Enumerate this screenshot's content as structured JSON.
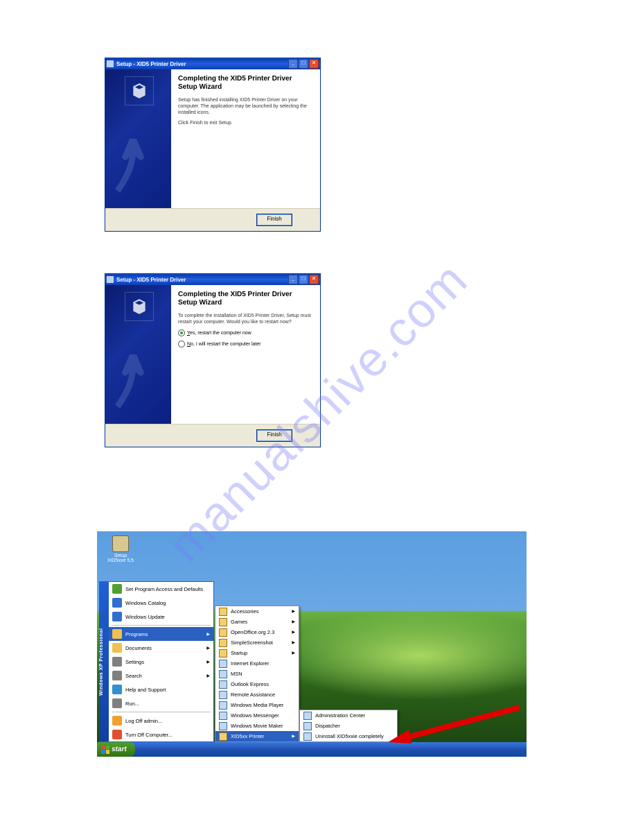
{
  "watermark": "manualshive.com",
  "dialog1": {
    "title": "Setup - XID5 Printer Driver",
    "titlebar_buttons": {
      "minimize": "_",
      "maximize": "□",
      "close": "×"
    },
    "heading": "Completing the XID5 Printer Driver Setup Wizard",
    "body1": "Setup has finished installing XID5 Printer Driver on your computer. The application may be launched by selecting the installed icons.",
    "body2": "Click Finish to exit Setup.",
    "finish": "Finish"
  },
  "dialog2": {
    "title": "Setup - XID5 Printer Driver",
    "titlebar_buttons": {
      "minimize": "_",
      "maximize": "□",
      "close": "×"
    },
    "heading": "Completing the XID5 Printer Driver Setup Wizard",
    "body1": "To complete the installation of XID5 Printer Driver, Setup must restart your computer. Would you like to restart now?",
    "radio_yes": "Yes, restart the computer now",
    "radio_no": "No, I will restart the computer later",
    "finish": "Finish"
  },
  "desktop": {
    "icon_label": "Setup XID5xxe 5.5",
    "sideband": "Windows XP  Professional",
    "start_label": "start",
    "startmenu_top": [
      {
        "label": "Set Program Access and Defaults"
      },
      {
        "label": "Windows Catalog"
      },
      {
        "label": "Windows Update"
      }
    ],
    "startmenu_main": [
      {
        "label": "Programs",
        "arrow": true,
        "highlight": true
      },
      {
        "label": "Documents",
        "arrow": true
      },
      {
        "label": "Settings",
        "arrow": true
      },
      {
        "label": "Search",
        "arrow": true
      },
      {
        "label": "Help and Support"
      },
      {
        "label": "Run..."
      }
    ],
    "startmenu_bottom": [
      {
        "label": "Log Off admin..."
      },
      {
        "label": "Turn Off Computer..."
      }
    ],
    "programs_menu": [
      {
        "label": "Accessories",
        "arrow": true
      },
      {
        "label": "Games",
        "arrow": true
      },
      {
        "label": "OpenOffice.org 2.3",
        "arrow": true
      },
      {
        "label": "SimpleScreenshot",
        "arrow": true
      },
      {
        "label": "Startup",
        "arrow": true
      },
      {
        "label": "Internet Explorer"
      },
      {
        "label": "MSN"
      },
      {
        "label": "Outlook Express"
      },
      {
        "label": "Remote Assistance"
      },
      {
        "label": "Windows Media Player"
      },
      {
        "label": "Windows Messenger"
      },
      {
        "label": "Windows Movie Maker"
      },
      {
        "label": "XID5xx Printer",
        "arrow": true,
        "highlight": true
      }
    ],
    "printer_menu": [
      {
        "label": "Administration Center"
      },
      {
        "label": "Dispatcher"
      },
      {
        "label": "Uninstall XID5xxie completely"
      }
    ]
  }
}
